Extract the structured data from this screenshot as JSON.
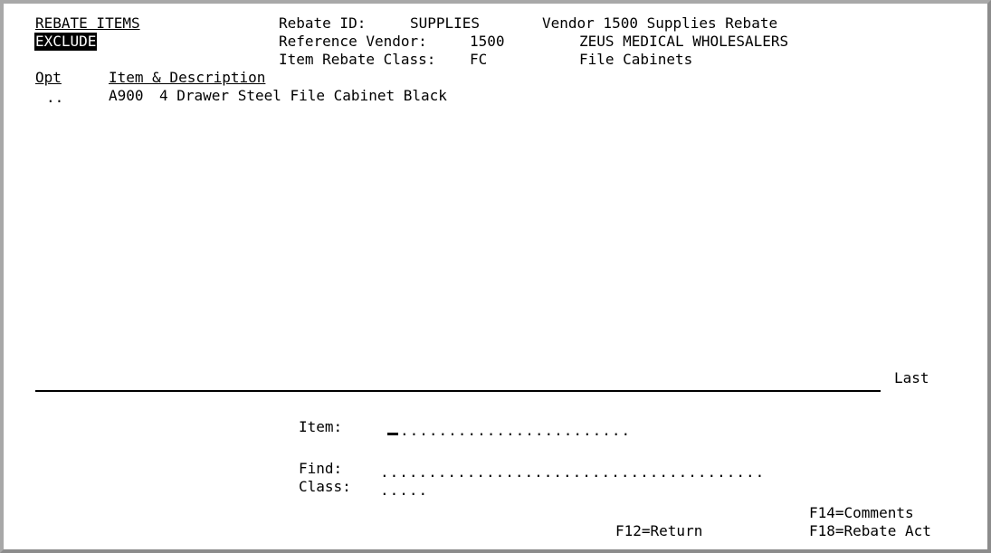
{
  "screen": {
    "title": "REBATE ITEMS",
    "mode": "EXCLUDE"
  },
  "header": {
    "rebate_id_label": "Rebate ID:",
    "rebate_id_value": "SUPPLIES",
    "rebate_desc": "Vendor 1500 Supplies Rebate",
    "ref_vendor_label": "Reference Vendor:",
    "ref_vendor_value": "1500",
    "ref_vendor_name": "ZEUS MEDICAL WHOLESALERS",
    "item_class_label": "Item Rebate Class:",
    "item_class_value": "FC",
    "item_class_desc": "File Cabinets"
  },
  "columns": {
    "opt": "Opt",
    "item_desc": "Item & Description"
  },
  "rows": [
    {
      "opt": "..",
      "item": "A900",
      "description": "4 Drawer Steel File Cabinet Black"
    }
  ],
  "list_status": "Last",
  "fields": {
    "item_label": "Item:",
    "item_dots": "........................",
    "find_label": "Find:",
    "find_dots": "........................................",
    "class_label": "Class:",
    "class_dots": "....."
  },
  "function_keys": {
    "f12": "F12=Return",
    "f14": "F14=Comments",
    "f18": "F18=Rebate Act"
  }
}
